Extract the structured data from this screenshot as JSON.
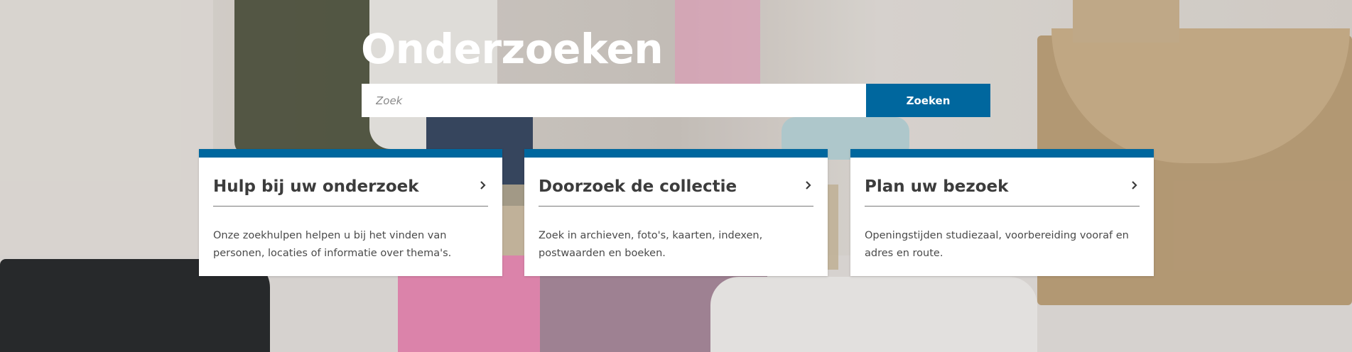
{
  "page": {
    "title": "Onderzoeken"
  },
  "search": {
    "placeholder": "Zoek",
    "button_label": "Zoeken"
  },
  "cards": [
    {
      "title": "Hulp bij uw onderzoek",
      "description": "Onze zoekhulpen helpen u bij het vinden van personen, locaties of informatie over thema's.",
      "icon": "chevron-right-icon"
    },
    {
      "title": "Doorzoek de collectie",
      "description": "Zoek in archieven, foto's, kaarten, indexen, postwaarden en boeken.",
      "icon": "chevron-right-icon"
    },
    {
      "title": "Plan uw bezoek",
      "description": "Openingstijden studiezaal, voorbereiding vooraf en adres en route.",
      "icon": "chevron-right-icon"
    }
  ],
  "colors": {
    "accent": "#00679e",
    "card_text": "#3c3c3c",
    "title_text": "#ffffff"
  }
}
